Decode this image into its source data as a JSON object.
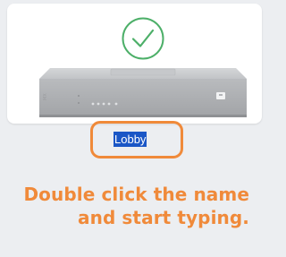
{
  "device": {
    "status_icon": "check-circle-icon",
    "status_color": "#4caf68",
    "name_value": "Lobby",
    "name_selected": true
  },
  "highlight_color": "#f08a3a",
  "instruction": {
    "line1": "Double click the name",
    "line2": "and start typing."
  }
}
